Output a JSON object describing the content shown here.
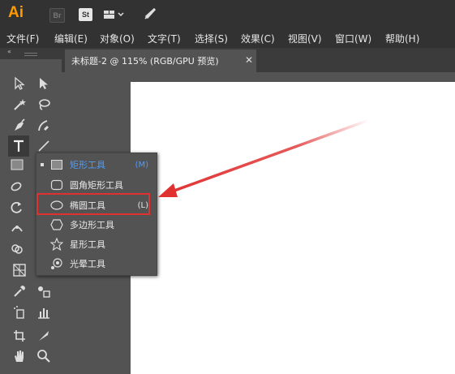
{
  "app": {
    "logo": "Ai",
    "bridge_label": "Br",
    "stock_label": "St"
  },
  "menu": [
    {
      "label": "文件(F)"
    },
    {
      "label": "编辑(E)"
    },
    {
      "label": "对象(O)"
    },
    {
      "label": "文字(T)"
    },
    {
      "label": "选择(S)"
    },
    {
      "label": "效果(C)"
    },
    {
      "label": "视图(V)"
    },
    {
      "label": "窗口(W)"
    },
    {
      "label": "帮助(H)"
    }
  ],
  "toolbar": {
    "collapse_glyph": "«"
  },
  "document_tab": {
    "title": "未标题-2 @ 115% (RGB/GPU 预览)",
    "close_glyph": "✕"
  },
  "flyout": {
    "items": [
      {
        "label": "矩形工具",
        "shortcut": "(M)",
        "icon": "rectangle-icon",
        "selected": true
      },
      {
        "label": "圆角矩形工具",
        "shortcut": "",
        "icon": "rounded-rectangle-icon",
        "selected": false
      },
      {
        "label": "椭圆工具",
        "shortcut": "(L)",
        "icon": "ellipse-icon",
        "selected": false
      },
      {
        "label": "多边形工具",
        "shortcut": "",
        "icon": "polygon-icon",
        "selected": false
      },
      {
        "label": "星形工具",
        "shortcut": "",
        "icon": "star-icon",
        "selected": false
      },
      {
        "label": "光晕工具",
        "shortcut": "",
        "icon": "flare-icon",
        "selected": false
      }
    ]
  },
  "colors": {
    "accent": "#ff9a00",
    "selected_text": "#4a9eff",
    "annotation": "#e03030"
  }
}
